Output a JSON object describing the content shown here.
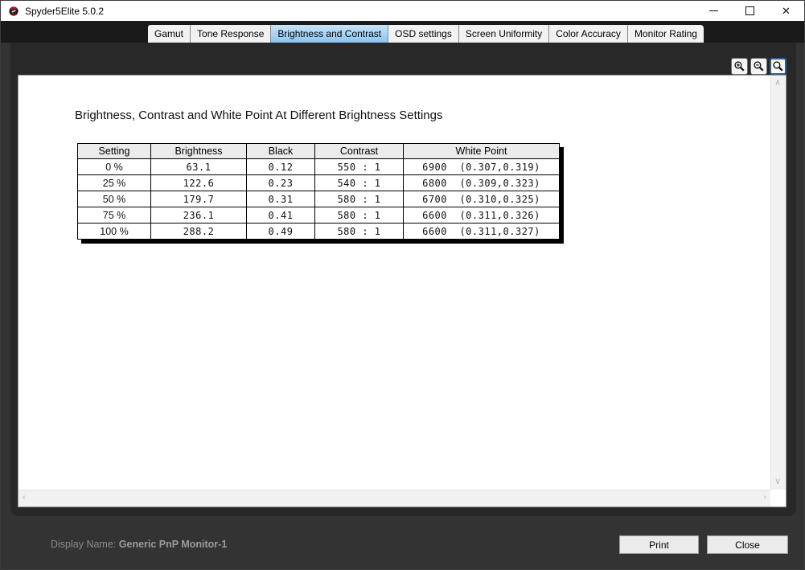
{
  "window": {
    "title": "Spyder5Elite 5.0.2",
    "icons": {
      "minimize": "minimize-icon",
      "maximize": "maximize-icon",
      "close": "✕"
    }
  },
  "tabs": [
    {
      "label": "Gamut",
      "selected": false
    },
    {
      "label": "Tone Response",
      "selected": false
    },
    {
      "label": "Brightness and Contrast",
      "selected": true
    },
    {
      "label": "OSD settings",
      "selected": false
    },
    {
      "label": "Screen Uniformity",
      "selected": false
    },
    {
      "label": "Color Accuracy",
      "selected": false
    },
    {
      "label": "Monitor Rating",
      "selected": false
    }
  ],
  "zoom_toolbar": {
    "zoom_in": "zoom-in",
    "zoom_out": "zoom-out",
    "zoom_fit": "zoom-fit",
    "active": "zoom_fit"
  },
  "report": {
    "title": "Brightness, Contrast and White Point At Different Brightness Settings",
    "table": {
      "headers": [
        "Setting",
        "Brightness",
        "Black",
        "Contrast",
        "White Point"
      ],
      "rows": [
        [
          "0 %",
          "63.1",
          "0.12",
          "550 : 1",
          "6900  (0.307,0.319)"
        ],
        [
          "25 %",
          "122.6",
          "0.23",
          "540 : 1",
          "6800  (0.309,0.323)"
        ],
        [
          "50 %",
          "179.7",
          "0.31",
          "580 : 1",
          "6700  (0.310,0.325)"
        ],
        [
          "75 %",
          "236.1",
          "0.41",
          "580 : 1",
          "6600  (0.311,0.326)"
        ],
        [
          "100 %",
          "288.2",
          "0.49",
          "580 : 1",
          "6600  (0.311,0.327)"
        ]
      ]
    }
  },
  "scrollbars": {
    "up": "∧",
    "down": "∨",
    "left": "‹",
    "right": "›"
  },
  "footer": {
    "display_name_label": "Display Name:",
    "display_name_value": "Generic PnP Monitor-1",
    "print_label": "Print",
    "close_label": "Close"
  },
  "colors": {
    "titlebar_bg": "#ffffff",
    "tabstrip_bg": "#191919",
    "selected_tab": "#a9d4f5",
    "window_bg": "#333333",
    "panel_bg": "#282828",
    "zoom_active_border": "#2e5e8f",
    "table_header_bg": "#ebebeb",
    "footer_text": "#8b8b8b"
  }
}
